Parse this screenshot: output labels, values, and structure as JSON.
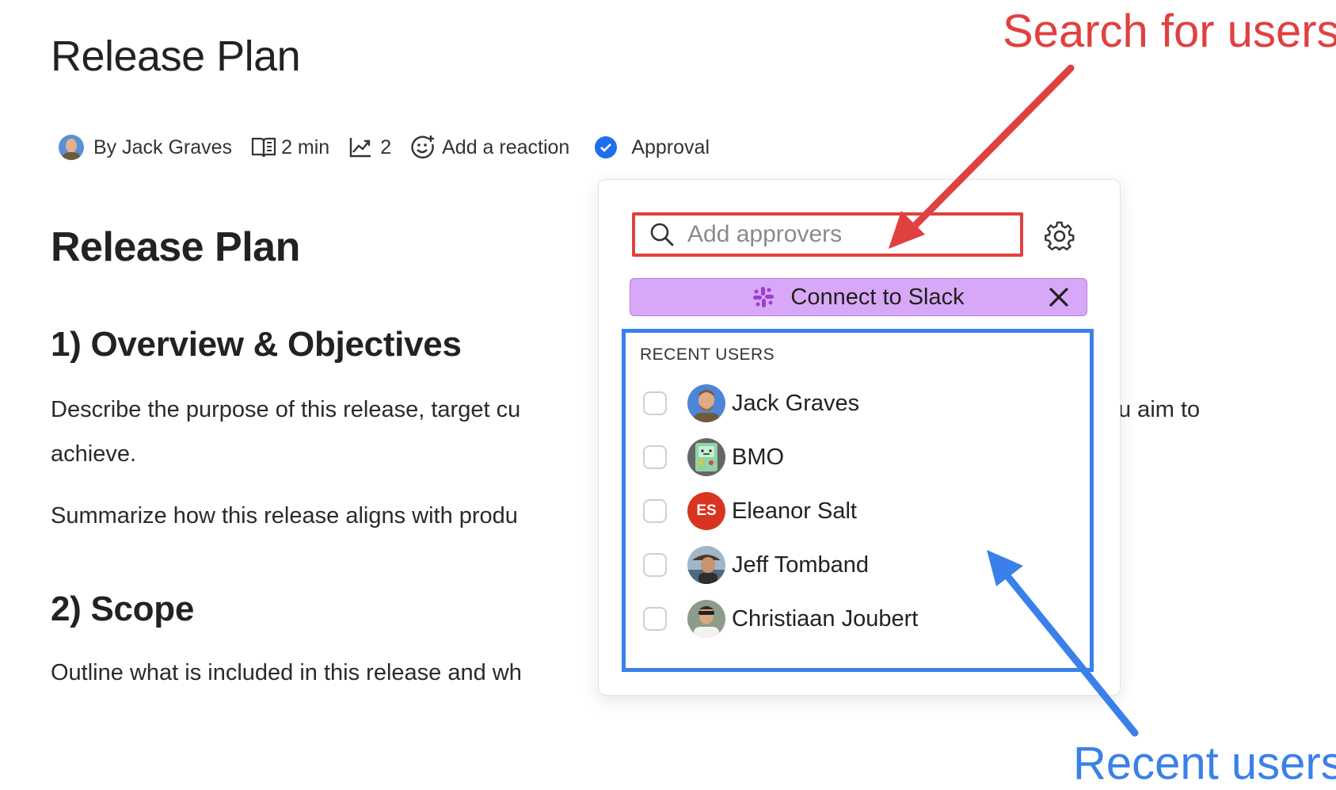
{
  "page": {
    "title": "Release Plan"
  },
  "meta": {
    "author": "By Jack Graves",
    "read_time": "2 min",
    "views": "2",
    "reaction": "Add a reaction",
    "approval": "Approval"
  },
  "doc": {
    "heading": "Release Plan",
    "section1_title": "1) Overview & Objectives",
    "section1_p1_a": "Describe the purpose of this release, target cu",
    "section1_p1_b": "u aim to",
    "section1_p1_c": "achieve.",
    "section1_p2": "Summarize how this release aligns with produ",
    "section2_title": "2) Scope",
    "section2_p1": "Outline what is included in this release and wh"
  },
  "popover": {
    "search_placeholder": "Add approvers",
    "slack_label": "Connect to Slack",
    "recent_title": "RECENT USERS",
    "users": [
      {
        "name": "Jack Graves",
        "avatar": "photo"
      },
      {
        "name": "BMO",
        "avatar": "bmo"
      },
      {
        "name": "Eleanor Salt",
        "avatar": "initials",
        "initials": "ES",
        "color": "#d9341f"
      },
      {
        "name": "Jeff Tomband",
        "avatar": "photo"
      },
      {
        "name": "Christiaan Joubert",
        "avatar": "photo"
      }
    ]
  },
  "annotations": {
    "search": "Search for users",
    "recent": "Recent users",
    "red": "#e0403f",
    "blue": "#3a80ea"
  },
  "icons": [
    "book-icon",
    "trend-icon",
    "smiley-add-icon",
    "check-circle-icon",
    "search-icon",
    "gear-icon",
    "slack-icon",
    "close-icon"
  ]
}
